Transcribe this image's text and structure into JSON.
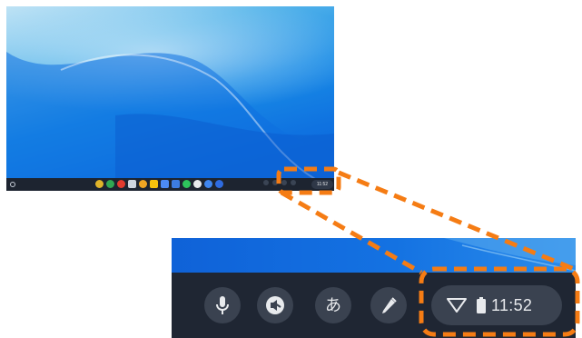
{
  "desktop": {
    "shelf": {
      "launcher_icon": "launcher-circle-icon",
      "apps": [
        {
          "name": "chrome-icon",
          "color": "#e0b42a"
        },
        {
          "name": "play-store-icon",
          "color": "#31a853"
        },
        {
          "name": "youtube-icon",
          "color": "#e33b2e"
        },
        {
          "name": "camera-icon",
          "color": "#cfd6df"
        },
        {
          "name": "photos-icon",
          "color": "#f0a623"
        },
        {
          "name": "keep-icon",
          "color": "#f4c20d"
        },
        {
          "name": "docs-icon",
          "color": "#4c8bf5"
        },
        {
          "name": "files-icon",
          "color": "#3d7ce0"
        },
        {
          "name": "spotify-icon",
          "color": "#2ec45c"
        },
        {
          "name": "messages-icon",
          "color": "#e8eaed"
        },
        {
          "name": "meet-icon",
          "color": "#3f86f0"
        },
        {
          "name": "chat-icon",
          "color": "#2e6be0"
        }
      ],
      "clock_text": "11:52"
    }
  },
  "zoomed_tray": {
    "buttons": [
      {
        "name": "microphone-icon"
      },
      {
        "name": "select-to-speak-icon"
      },
      {
        "name": "ime-button",
        "label": "あ"
      },
      {
        "name": "stylus-pen-icon"
      }
    ],
    "status": {
      "wifi_icon": "wifi-icon",
      "battery_icon": "battery-icon",
      "time": "11:52"
    }
  },
  "colors": {
    "callout": "#f57c14",
    "shelf": "#1f2633",
    "tray_button": "#3a4250",
    "icon": "#e8eaed"
  }
}
